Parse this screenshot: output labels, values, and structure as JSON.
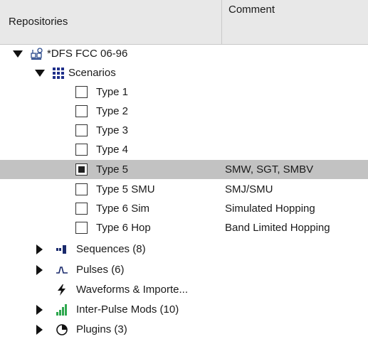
{
  "header": {
    "col_repositories": "Repositories",
    "col_comment": "Comment"
  },
  "tree": {
    "root": {
      "label": "*DFS FCC 06-96",
      "icon": "repository-icon",
      "expanded": true
    },
    "scenarios": {
      "label": "Scenarios",
      "icon": "grid-icon",
      "expanded": true
    },
    "types": [
      {
        "label": "Type 1",
        "comment": "",
        "checked": false,
        "selected": false
      },
      {
        "label": "Type 2",
        "comment": "",
        "checked": false,
        "selected": false
      },
      {
        "label": "Type 3",
        "comment": "",
        "checked": false,
        "selected": false
      },
      {
        "label": "Type 4",
        "comment": "",
        "checked": false,
        "selected": false
      },
      {
        "label": "Type 5",
        "comment": "SMW, SGT, SMBV",
        "checked": true,
        "selected": true
      },
      {
        "label": "Type 5 SMU",
        "comment": "SMJ/SMU",
        "checked": false,
        "selected": false
      },
      {
        "label": "Type 6 Sim",
        "comment": "Simulated Hopping",
        "checked": false,
        "selected": false
      },
      {
        "label": "Type 6 Hop",
        "comment": "Band Limited Hopping",
        "checked": false,
        "selected": false
      }
    ],
    "sequences": {
      "label": "Sequences (8)",
      "icon": "sequence-icon"
    },
    "pulses": {
      "label": "Pulses (6)",
      "icon": "pulse-icon"
    },
    "waveforms": {
      "label": "Waveforms & Importe...",
      "icon": "lightning-icon"
    },
    "interpulse": {
      "label": "Inter-Pulse Mods (10)",
      "icon": "bars-icon",
      "color": "#2fa84f"
    },
    "plugins": {
      "label": "Plugins (3)",
      "icon": "pie-icon"
    }
  },
  "colors": {
    "selection": "#c2c2c2",
    "header": "#e8e8e8"
  }
}
